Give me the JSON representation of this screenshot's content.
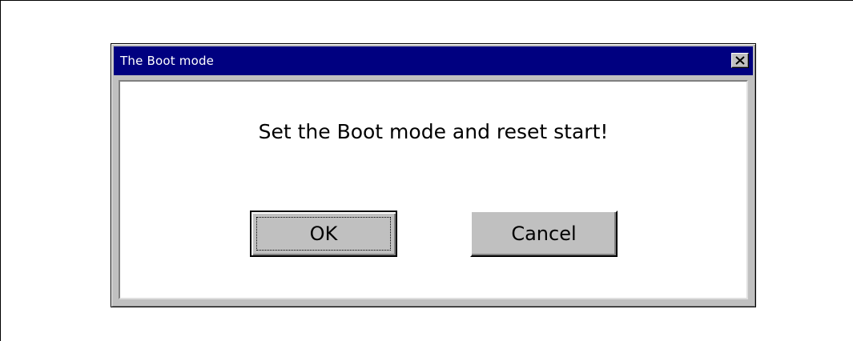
{
  "dialog": {
    "title": "The Boot mode",
    "close_icon": "close-x-icon",
    "message": "Set the Boot mode and reset start!",
    "buttons": {
      "ok_label": "OK",
      "cancel_label": "Cancel"
    }
  },
  "colors": {
    "titlebar": "#000080",
    "title_text": "#ffffff",
    "window_face": "#c0c0c0",
    "client_background": "#ffffff"
  }
}
